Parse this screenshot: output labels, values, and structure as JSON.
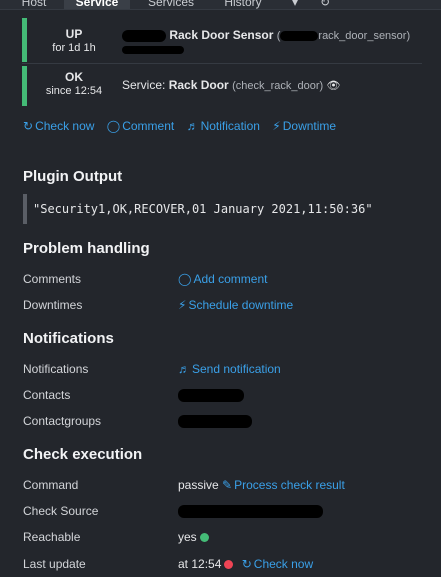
{
  "tabs": [
    {
      "label": "Host"
    },
    {
      "label": "Service"
    },
    {
      "label": "Services"
    },
    {
      "label": "History"
    }
  ],
  "host_state": {
    "state": "UP",
    "since": "for 1d 1h",
    "name": "Rack Door Sensor",
    "check_name_suffix": "rack_door_sensor)",
    "color": "#44bb77"
  },
  "service_state": {
    "state": "OK",
    "since": "since 12:54",
    "prefix": "Service:",
    "name": "Rack Door",
    "check_name": "(check_rack_door)",
    "color": "#44bb77"
  },
  "quick_actions": [
    {
      "label": "Check now",
      "icon": "refresh-icon"
    },
    {
      "label": "Comment",
      "icon": "comment-icon"
    },
    {
      "label": "Notification",
      "icon": "bell-icon"
    },
    {
      "label": "Downtime",
      "icon": "plug-icon"
    }
  ],
  "plugin_output": {
    "heading": "Plugin Output",
    "text": "\"Security1,OK,RECOVER,01 January 2021,11:50:36\""
  },
  "problem_handling": {
    "heading": "Problem handling",
    "comments_label": "Comments",
    "add_comment": "Add comment",
    "downtimes_label": "Downtimes",
    "schedule_downtime": "Schedule downtime"
  },
  "notifications": {
    "heading": "Notifications",
    "notifications_label": "Notifications",
    "send_notification": "Send notification",
    "contacts_label": "Contacts",
    "contactgroups_label": "Contactgroups"
  },
  "check_execution": {
    "heading": "Check execution",
    "command_label": "Command",
    "command_value": "passive",
    "process_check_result": "Process check result",
    "check_source_label": "Check Source",
    "reachable_label": "Reachable",
    "reachable_value": "yes",
    "last_update_label": "Last update",
    "last_update_value": "at 12:54",
    "check_now": "Check now",
    "colors": {
      "ok": "#44bb77",
      "critical": "#ee4455"
    }
  }
}
